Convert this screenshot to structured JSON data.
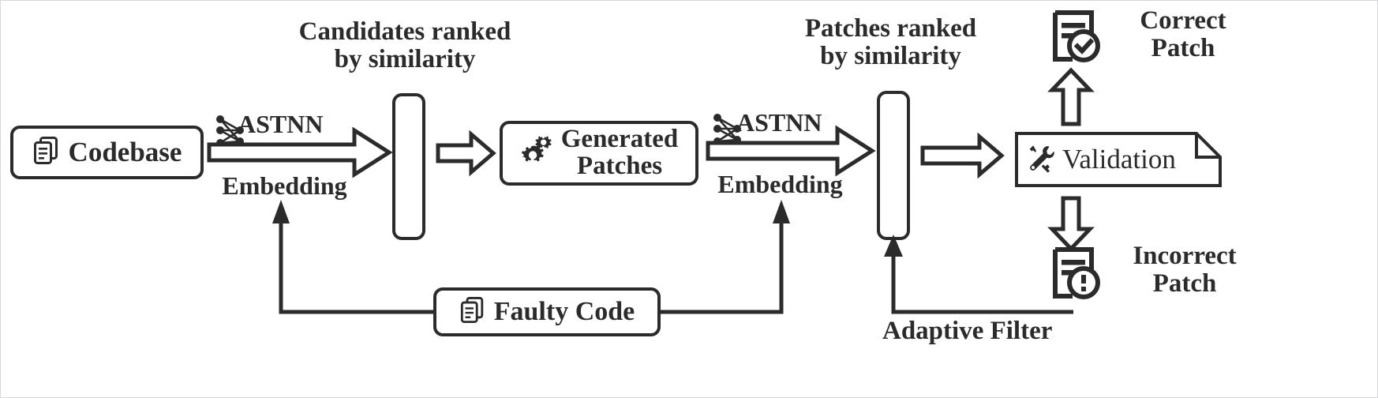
{
  "diagram": {
    "title": "APR pipeline with ASTNN embedding and adaptive filter",
    "ink_color": "#2b2b2b",
    "background": "#ffffff"
  },
  "nodes": {
    "codebase": {
      "label": "Codebase",
      "icon": "documents-icon"
    },
    "generated_patches": {
      "label": "Generated\nPatches",
      "icon": "gears-icon"
    },
    "faulty_code": {
      "label": "Faulty Code",
      "icon": "documents-icon"
    },
    "validation": {
      "label": "Validation",
      "icon": "tools-icon"
    }
  },
  "bars": {
    "candidate_bar": {
      "name": "candidate-ranking-bar"
    },
    "patch_bar": {
      "name": "patch-ranking-bar"
    }
  },
  "labels": {
    "candidates_ranked": "Candidates ranked\nby similarity",
    "patches_ranked": "Patches ranked\nby similarity",
    "astnn_left": "ASTNN",
    "embedding_left": "Embedding",
    "astnn_right": "ASTNN",
    "embedding_right": "Embedding",
    "correct_patch": "Correct\nPatch",
    "incorrect_patch": "Incorrect\nPatch",
    "adaptive_filter": "Adaptive Filter"
  },
  "icons": {
    "astnn_left": "neural-network-icon",
    "astnn_right": "neural-network-icon",
    "correct_patch": "document-check-icon",
    "incorrect_patch": "document-alert-icon"
  },
  "arrows": {
    "codebase_to_bar": "block-arrow-right",
    "bar_to_generated": "block-arrow-right-small",
    "generated_to_bar2": "block-arrow-right",
    "bar2_to_validation": "block-arrow-right-small",
    "validation_to_correct": "block-arrow-up",
    "validation_to_incorrect": "block-arrow-down",
    "faulty_to_left_embed": "line-arrow-up",
    "faulty_to_right_embed": "line-arrow-up",
    "filter_feedback": "line-arrow-up"
  }
}
